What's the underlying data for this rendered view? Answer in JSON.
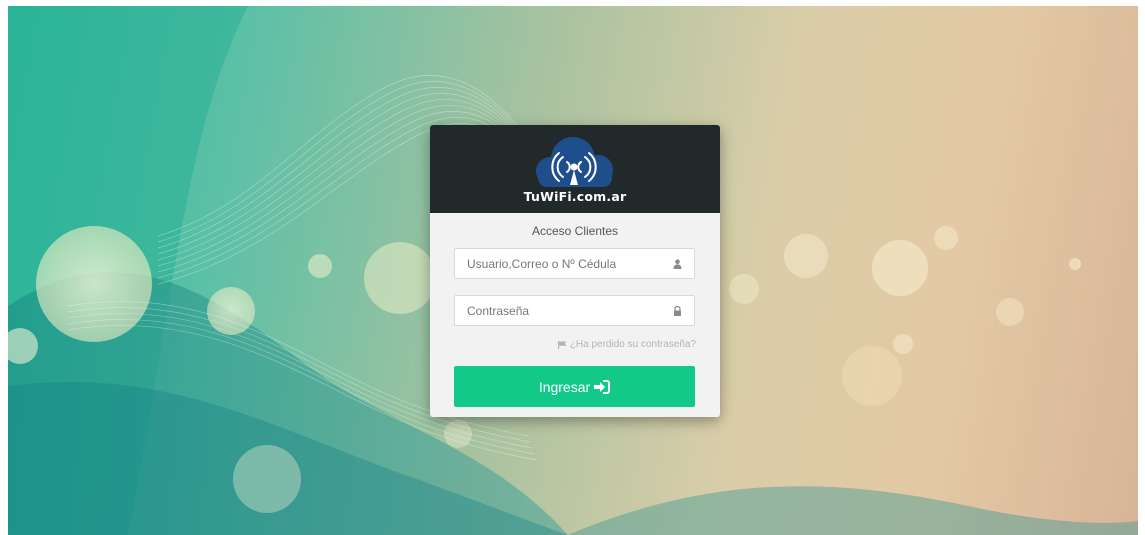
{
  "brand": {
    "name": "TuWiFi.com.ar"
  },
  "login": {
    "title": "Acceso Clientes",
    "username_placeholder": "Usuario,Correo o Nº Cédula",
    "password_placeholder": "Contraseña",
    "forgot_label": "¿Ha perdido su contraseña?",
    "submit_label": "Ingresar"
  },
  "icons": {
    "username_field": "user-icon",
    "password_field": "lock-icon",
    "forgot_link": "flag-icon",
    "submit": "sign-in-icon",
    "logo": "wifi-cloud-icon"
  },
  "colors": {
    "header_bg": "#22292b",
    "card_bg": "#f2f2f2",
    "button_bg": "#12c98a",
    "cloud_blue": "#1f4e8c"
  }
}
